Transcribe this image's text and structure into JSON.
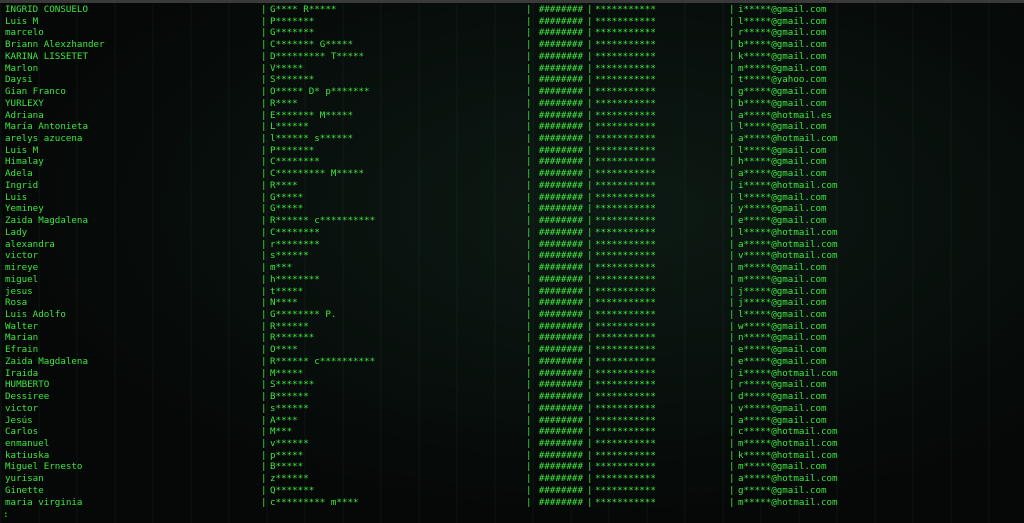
{
  "terminal": {
    "prompt": ":",
    "text_color": "#3ee63e",
    "background": "#050807",
    "separator": "|",
    "note": "",
    "rows": [
      [
        "INGRID CONSUELO",
        "G**** R*****",
        "########",
        "***********",
        "i*****@gmail.com"
      ],
      [
        "Luis M",
        "P*******",
        "########",
        "***********",
        "l*****@gmail.com"
      ],
      [
        "marcelo",
        "G*******",
        "########",
        "***********",
        "r*****@gmail.com"
      ],
      [
        "Briann Alexzhander",
        "C******* G*****",
        "########",
        "***********",
        "b*****@gmail.com"
      ],
      [
        "KARINA LISSETET",
        "D********* T*****",
        "########",
        "***********",
        "k*****@gmail.com"
      ],
      [
        "Marlon",
        "V*****",
        "########",
        "***********",
        "m*****@gmail.com"
      ],
      [
        "Daysi",
        "S*******",
        "########",
        "***********",
        "t*****@yahoo.com"
      ],
      [
        "Gian Franco",
        "O***** D* p*******",
        "########",
        "***********",
        "g*****@gmail.com"
      ],
      [
        "YURLEXY",
        "R****",
        "########",
        "***********",
        "b*****@gmail.com"
      ],
      [
        "Adriana",
        "E******* M*****",
        "########",
        "***********",
        "a*****@hotmail.es"
      ],
      [
        "María Antonieta",
        "L******",
        "########",
        "***********",
        "l*****@gmail.com"
      ],
      [
        "arelys azucena",
        "l****** s******",
        "########",
        "***********",
        "a*****@hotmail.com"
      ],
      [
        "Luis M",
        "P*******",
        "########",
        "***********",
        "l*****@gmail.com"
      ],
      [
        "Himalay",
        "C********",
        "########",
        "***********",
        "h*****@gmail.com"
      ],
      [
        "Adela",
        "C********* M*****",
        "########",
        "***********",
        "a*****@gmail.com"
      ],
      [
        "Ingrid",
        "R****",
        "########",
        "***********",
        "i*****@hotmail.com"
      ],
      [
        "Luis",
        "G*****",
        "########",
        "***********",
        "l*****@gmail.com"
      ],
      [
        "Yeminey",
        "G*****",
        "########",
        "***********",
        "y*****@gmail.com"
      ],
      [
        "Zaida Magdalena",
        "R****** c**********",
        "########",
        "***********",
        "e*****@gmail.com"
      ],
      [
        "Lady",
        "C********",
        "########",
        "***********",
        "l*****@hotmail.com"
      ],
      [
        "alexandra",
        "r********",
        "########",
        "***********",
        "a*****@hotmail.com"
      ],
      [
        "victor",
        "s******",
        "########",
        "***********",
        "v*****@hotmail.com"
      ],
      [
        "mireye",
        "m***",
        "########",
        "***********",
        "m*****@gmail.com"
      ],
      [
        "miguel",
        "h********",
        "########",
        "***********",
        "m*****@gmail.com"
      ],
      [
        "jesus",
        "t*****",
        "########",
        "***********",
        "j*****@gmail.com"
      ],
      [
        "Rosa",
        "N****",
        "########",
        "***********",
        "j*****@gmail.com"
      ],
      [
        "Luis Adolfo",
        "G******** P.",
        "########",
        "***********",
        "l*****@gmail.com"
      ],
      [
        "Walter",
        "R******",
        "########",
        "***********",
        "w*****@gmail.com"
      ],
      [
        "Marian",
        "R*******",
        "########",
        "***********",
        "n*****@gmail.com"
      ],
      [
        "Efrain",
        "O****",
        "########",
        "***********",
        "e*****@gmail.com"
      ],
      [
        "Zaida Magdalena",
        "R****** c**********",
        "########",
        "***********",
        "e*****@gmail.com"
      ],
      [
        "Iraida",
        "M*****",
        "########",
        "***********",
        "i*****@hotmail.com"
      ],
      [
        "HUMBERTO",
        "S*******",
        "########",
        "***********",
        "r*****@gmail.com"
      ],
      [
        "Dessiree",
        "B******",
        "########",
        "***********",
        "d*****@gmail.com"
      ],
      [
        "victor",
        "s******",
        "########",
        "***********",
        "v*****@gmail.com"
      ],
      [
        "Jesús",
        "A****",
        "########",
        "***********",
        "a*****@gmail.com"
      ],
      [
        "Carlos",
        "M***",
        "########",
        "***********",
        "c*****@hotmail.com"
      ],
      [
        "enmanuel",
        "v******",
        "########",
        "***********",
        "m*****@hotmail.com"
      ],
      [
        "katiuska",
        "p*****",
        "########",
        "***********",
        "k*****@hotmail.com"
      ],
      [
        "Miguel Ernesto",
        "B*****",
        "########",
        "***********",
        "m*****@gmail.com"
      ],
      [
        "yurisan",
        "z******",
        "########",
        "***********",
        "a*****@hotmail.com"
      ],
      [
        "Ginette",
        "Q*******",
        "########",
        "***********",
        "g*****@gmail.com"
      ],
      [
        "maria virginia",
        "c********* m****",
        "########",
        "***********",
        "m*****@hotmail.com"
      ]
    ]
  }
}
